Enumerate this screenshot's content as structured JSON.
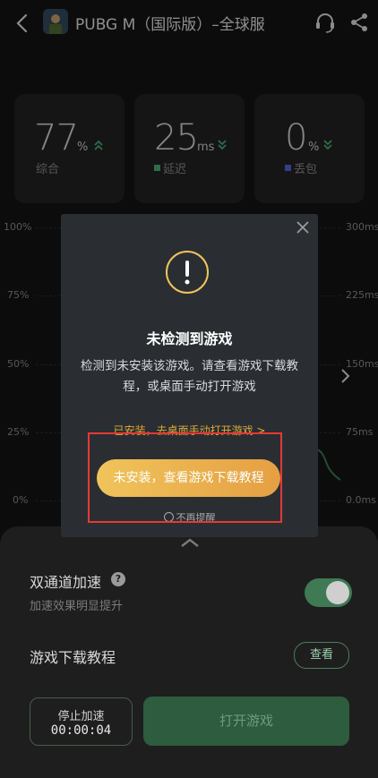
{
  "header": {
    "title": "PUBG M（国际版）–全球服"
  },
  "stats": {
    "overall": {
      "value": "77",
      "unit": "%",
      "label": "综合"
    },
    "latency": {
      "value": "25",
      "unit": "ms",
      "label": "延迟"
    },
    "loss": {
      "value": "0",
      "unit": "%",
      "label": "丢包"
    }
  },
  "chart": {
    "left_ticks": [
      "100%",
      "75%",
      "50%",
      "25%",
      "0%"
    ],
    "right_ticks": [
      "300ms",
      "225ms",
      "150ms",
      "75ms",
      "0.0ms"
    ]
  },
  "modal": {
    "title": "未检测到游戏",
    "message": "检测到未安装该游戏。请查看游戏下载教程，或桌面手动打开游戏",
    "installed_link": "已安装，去桌面手动打开游戏 >",
    "primary_button": "未安装，查看游戏下载教程",
    "no_remind": "不再提醒"
  },
  "sheet": {
    "dual_channel": {
      "title": "双通道加速",
      "subtitle": "加速效果明显提升",
      "help": "?",
      "enabled": true
    },
    "tutorial": {
      "title": "游戏下载教程",
      "button": "查看"
    },
    "stop": {
      "label": "停止加速",
      "timer": "00:00:04"
    },
    "open_game": "打开游戏"
  },
  "colors": {
    "accent_green": "#3f7a55",
    "latency_dot": "#4caf7a",
    "loss_dot": "#5a63d8",
    "warning_yellow": "#f0c45b",
    "annotation_red": "#e53935"
  },
  "icons": [
    "back-icon",
    "game-app-icon",
    "headset-icon",
    "share-icon",
    "double-up-arrow-icon",
    "double-down-arrow-icon",
    "close-icon",
    "warning-icon",
    "chevron-up-icon",
    "chevron-right-icon",
    "help-icon"
  ]
}
